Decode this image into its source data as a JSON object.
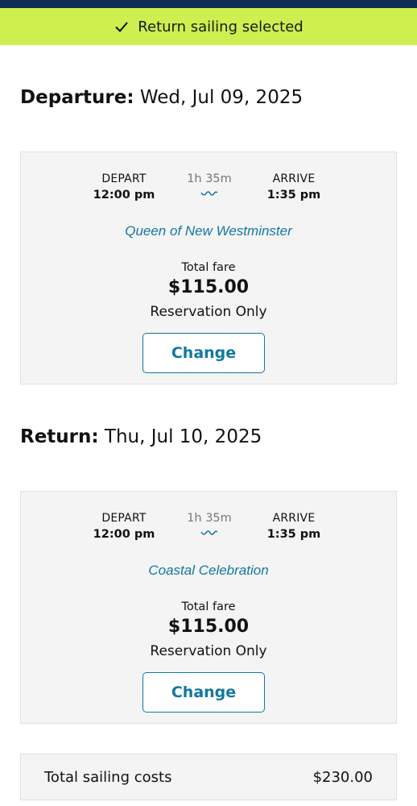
{
  "banner": {
    "text": "Return sailing selected",
    "icon": "checkmark-icon"
  },
  "departure": {
    "heading_label": "Departure:",
    "heading_date": "Wed, Jul 09, 2025",
    "depart_label": "DEPART",
    "depart_time": "12:00 pm",
    "duration": "1h  35m",
    "arrive_label": "ARRIVE",
    "arrive_time": "1:35 pm",
    "vessel": "Queen of New Westminster",
    "fare_label": "Total fare",
    "fare_amount": "$115.00",
    "fare_type": "Reservation Only",
    "change_label": "Change"
  },
  "return": {
    "heading_label": "Return:",
    "heading_date": "Thu, Jul 10, 2025",
    "depart_label": "DEPART",
    "depart_time": "12:00 pm",
    "duration": "1h  35m",
    "arrive_label": "ARRIVE",
    "arrive_time": "1:35 pm",
    "vessel": "Coastal Celebration",
    "fare_label": "Total fare",
    "fare_amount": "$115.00",
    "fare_type": "Reservation Only",
    "change_label": "Change"
  },
  "total": {
    "label": "Total sailing costs",
    "value": "$230.00"
  },
  "colors": {
    "banner": "#cdef50",
    "header": "#0b2d55",
    "accent": "#12789f",
    "card_bg": "#f4f4f4"
  }
}
